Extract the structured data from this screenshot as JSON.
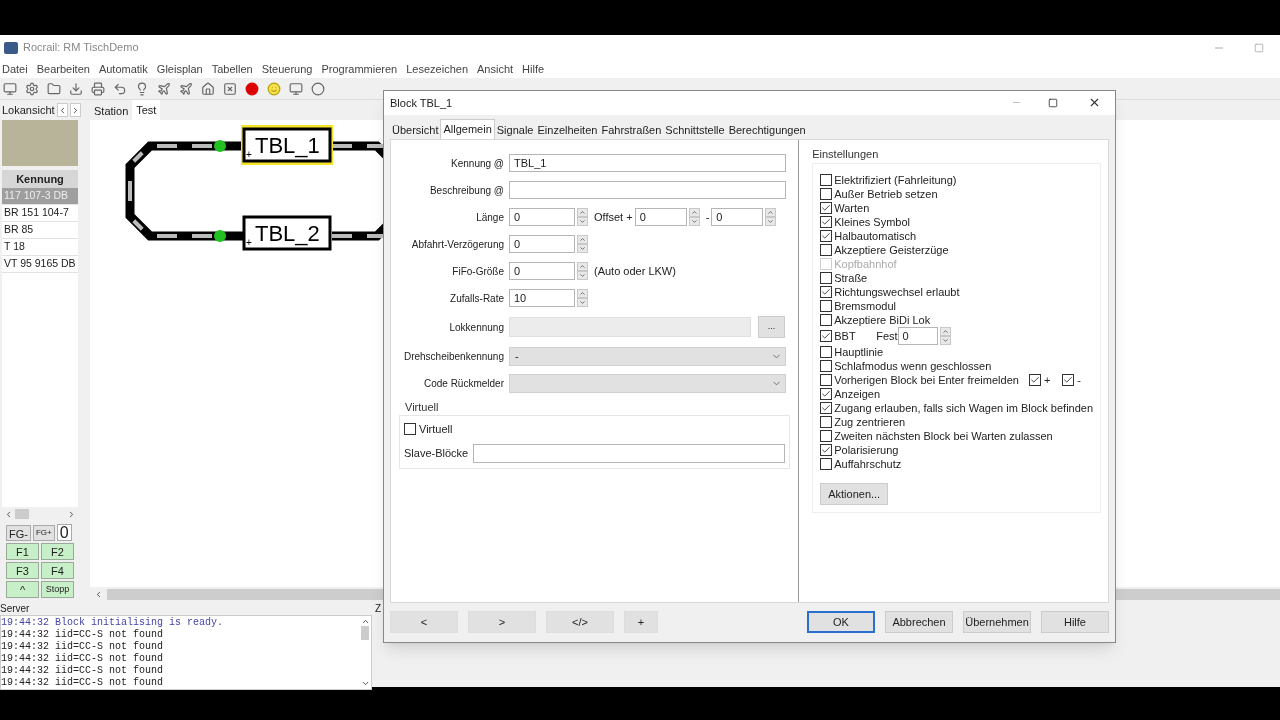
{
  "window": {
    "title": "Rocrail: RM TischDemo"
  },
  "menu": [
    "Datei",
    "Bearbeiten",
    "Automatik",
    "Gleisplan",
    "Tabellen",
    "Steuerung",
    "Programmieren",
    "Lesezeichen",
    "Ansicht",
    "Hilfe"
  ],
  "loco_panel": {
    "tab": "Lokansicht",
    "column": "Kennung",
    "rows": [
      {
        "text": "117 107-3 DB",
        "selected": true
      },
      {
        "text": "BR 151 104-7",
        "selected": false
      },
      {
        "text": "BR 85",
        "selected": false
      },
      {
        "text": "T 18",
        "selected": false
      },
      {
        "text": "VT 95 9165 DB",
        "selected": false
      }
    ],
    "group_buttons": [
      "FG-",
      "FG+"
    ],
    "counter": "0",
    "function_buttons": [
      "F1",
      "F2",
      "F3",
      "F4",
      "^",
      "Stopp"
    ]
  },
  "plan": {
    "tabs": [
      {
        "label": "Station",
        "selected": false
      },
      {
        "label": "Test",
        "selected": true
      }
    ],
    "blocks": [
      {
        "label": "TBL_1",
        "marker": "+",
        "selected": true
      },
      {
        "label": "TBL_2",
        "marker": "+",
        "selected": false
      }
    ]
  },
  "server": {
    "title": "Server",
    "side_title": "Z",
    "lines": [
      {
        "text": "19:44:32 Block initialising is ready.",
        "kind": "info"
      },
      {
        "text": "19:44:32 iid=CC-S not found",
        "kind": "plain"
      },
      {
        "text": "19:44:32 iid=CC-S not found",
        "kind": "plain"
      },
      {
        "text": "19:44:32 iid=CC-S not found",
        "kind": "plain"
      },
      {
        "text": "19:44:32 iid=CC-S not found",
        "kind": "plain"
      },
      {
        "text": "19:44:32 iid=CC-S not found",
        "kind": "plain"
      }
    ]
  },
  "dialog": {
    "title": "Block TBL_1",
    "tabs": [
      {
        "label": "Übersicht",
        "selected": false
      },
      {
        "label": "Allgemein",
        "selected": true
      },
      {
        "label": "Signale",
        "selected": false
      },
      {
        "label": "Einzelheiten",
        "selected": false
      },
      {
        "label": "Fahrstraßen",
        "selected": false
      },
      {
        "label": "Schnittstelle",
        "selected": false
      },
      {
        "label": "Berechtigungen",
        "selected": false
      }
    ],
    "fields": [
      {
        "label": "Kennung @",
        "kind": "text",
        "value": "TBL_1"
      },
      {
        "label": "Beschreibung @",
        "kind": "text"
      },
      {
        "label": "Länge",
        "kind": "spin",
        "value": "0",
        "extras": [
          {
            "label": "Offset +",
            "value": "0"
          },
          {
            "label": "-",
            "value": "0"
          }
        ]
      },
      {
        "label": "Abfahrt-Verzögerung",
        "kind": "spin",
        "value": "0"
      },
      {
        "label": "FiFo-Größe",
        "kind": "spin",
        "value": "0",
        "note": "(Auto oder LKW)"
      },
      {
        "label": "Zufalls-Rate",
        "kind": "spin",
        "value": "10"
      },
      {
        "label": "Lokkennung",
        "kind": "picker",
        "button": "..."
      },
      {
        "label": "Drehscheibenkennung",
        "kind": "select",
        "value": "-"
      },
      {
        "label": "Code Rückmelder",
        "kind": "select"
      }
    ],
    "virtual": {
      "title": "Virtuell",
      "checkbox": {
        "label": "Virtuell",
        "checked": false
      },
      "slave_label": "Slave-Blöcke"
    },
    "settings": {
      "title": "Einstellungen",
      "items": [
        {
          "kind": "check",
          "label": "Elektrifiziert (Fahrleitung)",
          "checked": false
        },
        {
          "kind": "check",
          "label": "Außer Betrieb setzen",
          "checked": false
        },
        {
          "kind": "check",
          "label": "Warten",
          "checked": true
        },
        {
          "kind": "check",
          "label": "Kleines Symbol",
          "checked": true
        },
        {
          "kind": "check",
          "label": "Halbautomatisch",
          "checked": true
        },
        {
          "kind": "check",
          "label": "Akzeptiere Geisterzüge",
          "checked": false
        },
        {
          "kind": "check",
          "label": "Kopfbahnhof",
          "checked": false,
          "disabled": true
        },
        {
          "kind": "check",
          "label": "Straße",
          "checked": false
        },
        {
          "kind": "check",
          "label": "Richtungswechsel erlaubt",
          "checked": true
        },
        {
          "kind": "check",
          "label": "Bremsmodul",
          "checked": false
        },
        {
          "kind": "check",
          "label": "Akzeptiere BiDi Lok",
          "checked": false
        },
        {
          "kind": "spin",
          "label": "BBT",
          "checked": true,
          "spin_label": "Fest",
          "value": "0"
        },
        {
          "kind": "check",
          "label": "Hauptlinie",
          "checked": false
        },
        {
          "kind": "check",
          "label": "Schlafmodus wenn geschlossen",
          "checked": false
        },
        {
          "kind": "pair",
          "label": "Vorherigen Block bei Enter freimelden",
          "checked": false,
          "options": [
            {
              "label": "+",
              "checked": true
            },
            {
              "label": "-",
              "checked": true
            }
          ]
        },
        {
          "kind": "check",
          "label": "Anzeigen",
          "checked": true
        },
        {
          "kind": "check",
          "label": "Zugang erlauben, falls sich Wagen im Block befinden",
          "checked": true
        },
        {
          "kind": "check",
          "label": "Zug zentrieren",
          "checked": false
        },
        {
          "kind": "check",
          "label": "Zweiten nächsten Block bei Warten zulassen",
          "checked": false
        },
        {
          "kind": "check",
          "label": "Polarisierung",
          "checked": true
        },
        {
          "kind": "check",
          "label": "Auffahrschutz",
          "checked": false
        }
      ],
      "button": "Aktionen..."
    },
    "nav_buttons": [
      "<",
      ">",
      "</>",
      "+"
    ],
    "buttons": [
      {
        "label": "OK",
        "default": true
      },
      {
        "label": "Abbrechen",
        "default": false
      },
      {
        "label": "Übernehmen",
        "default": false
      },
      {
        "label": "Hilfe",
        "default": false
      }
    ]
  }
}
